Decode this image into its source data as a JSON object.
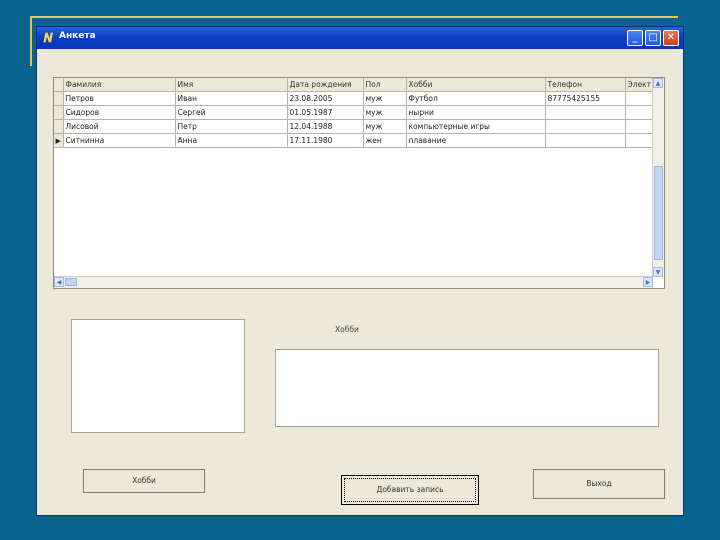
{
  "window": {
    "title": "Анкета",
    "buttons": {
      "minimize": "_",
      "maximize": "□",
      "close": "✕"
    }
  },
  "grid": {
    "columns": [
      "Фамилия",
      "Имя",
      "Дата рождения",
      "Пол",
      "Хобби",
      "Телефон",
      "Элект"
    ],
    "rows": [
      [
        "Петров",
        "Иван",
        "23.08.2005",
        "муж",
        "Футбол",
        "87775425155",
        ""
      ],
      [
        "Сидоров",
        "Сергей",
        "01.05.1987",
        "муж",
        "нырни",
        "",
        ""
      ],
      [
        "Лисовой",
        "Петр",
        "12.04.1988",
        "муж",
        "компьютерные игры",
        "",
        ""
      ],
      [
        "Ситнинна",
        "Анна",
        "17.11.1980",
        "жен",
        "плавание",
        "",
        ""
      ]
    ],
    "current_row_indicator": "▶"
  },
  "hobby_label": "Хобби",
  "buttons": {
    "hobby": "Хобби",
    "add_record": "Добавить запись",
    "exit": "Выход"
  },
  "icons": {
    "app": "app-icon",
    "scroll_up": "▲",
    "scroll_down": "▼",
    "scroll_left": "◀",
    "scroll_right": "▶"
  },
  "colors": {
    "slide_background": "#08638f",
    "titlebar": "#0a3fc7",
    "window_face": "#ece9d8"
  }
}
